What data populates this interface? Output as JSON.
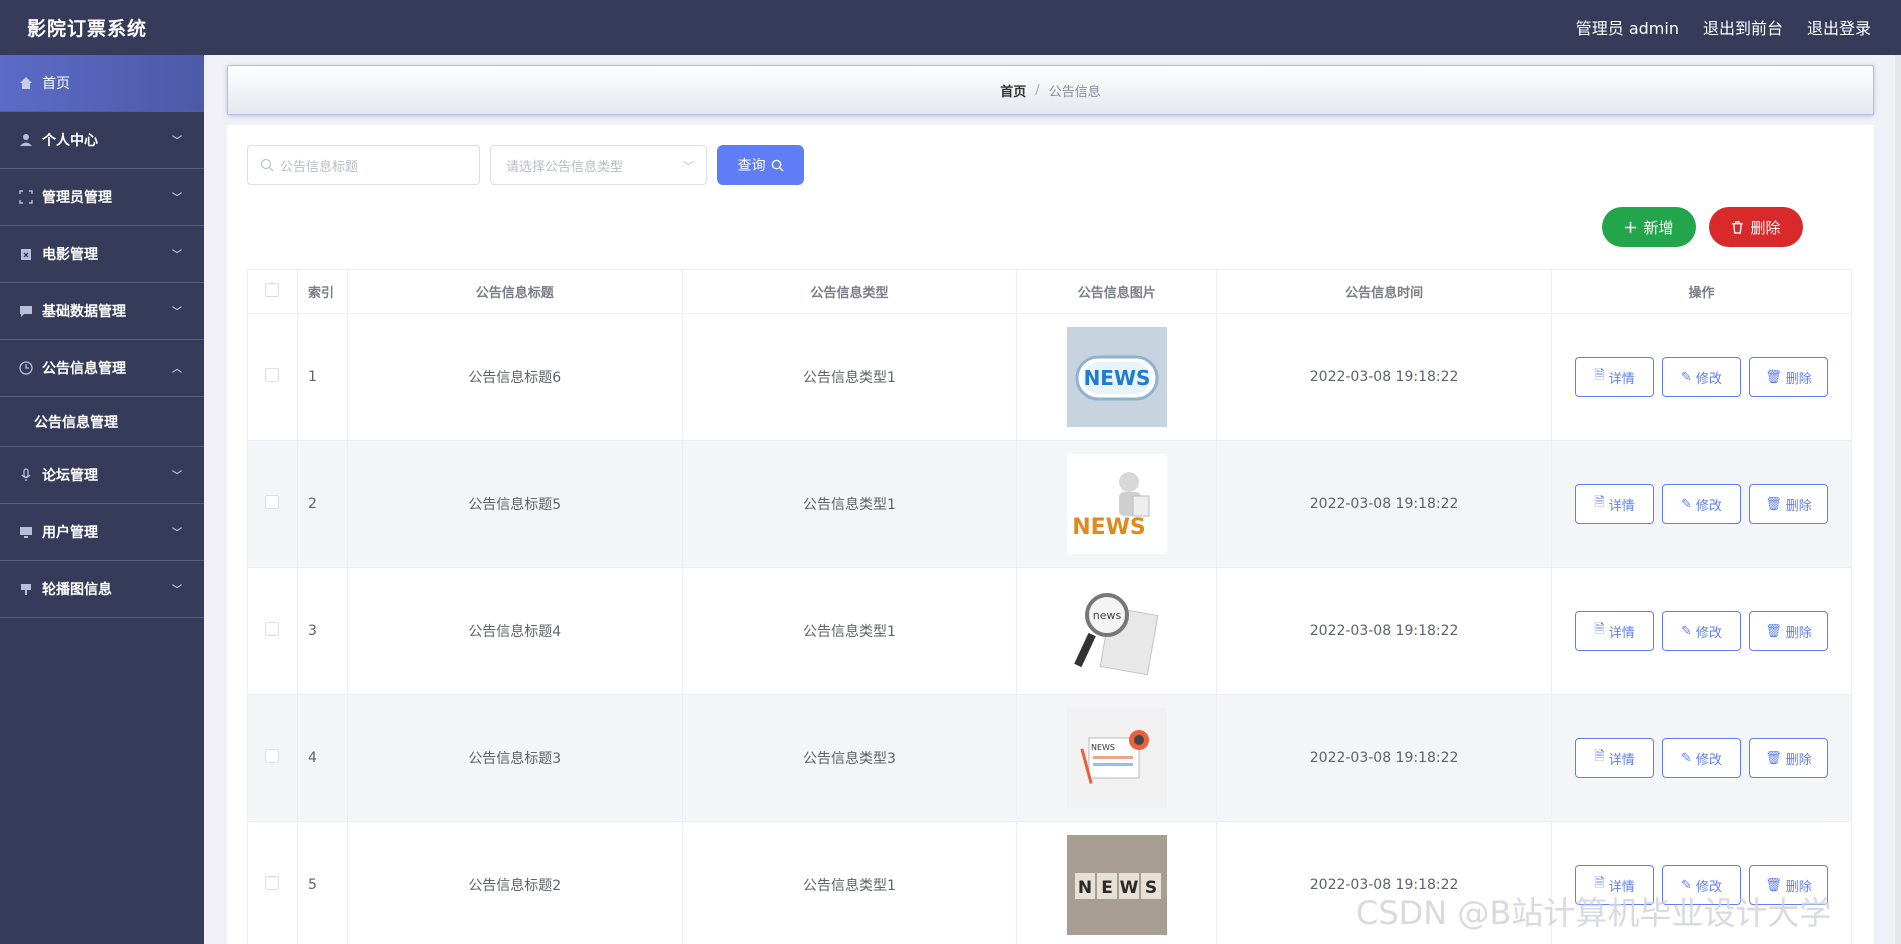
{
  "app": {
    "title": "影院订票系统",
    "user_label": "管理员 admin",
    "back_to_front": "退出到前台",
    "logout": "退出登录"
  },
  "sidebar": {
    "items": [
      {
        "label": "首页",
        "icon": "home-icon"
      },
      {
        "label": "个人中心",
        "icon": "user-icon"
      },
      {
        "label": "管理员管理",
        "icon": "frame-icon"
      },
      {
        "label": "电影管理",
        "icon": "clipboard-icon"
      },
      {
        "label": "基础数据管理",
        "icon": "chat-icon"
      },
      {
        "label": "公告信息管理",
        "icon": "clock-icon"
      },
      {
        "label": "论坛管理",
        "icon": "mic-icon"
      },
      {
        "label": "用户管理",
        "icon": "monitor-icon"
      },
      {
        "label": "轮播图信息",
        "icon": "sign-icon"
      }
    ],
    "sub_item": "公告信息管理"
  },
  "breadcrumb": {
    "home": "首页",
    "separator": "/",
    "current": "公告信息"
  },
  "search": {
    "title_placeholder": "公告信息标题",
    "type_placeholder": "请选择公告信息类型",
    "query_label": "查询"
  },
  "actions": {
    "add_label": "新增",
    "delete_label": "删除"
  },
  "table": {
    "headers": {
      "index": "索引",
      "title": "公告信息标题",
      "type": "公告信息类型",
      "image": "公告信息图片",
      "time": "公告信息时间",
      "ops": "操作"
    },
    "op_labels": {
      "detail": "详情",
      "edit": "修改",
      "delete": "删除"
    },
    "rows": [
      {
        "index": "1",
        "title": "公告信息标题6",
        "type": "公告信息类型1",
        "image": "news-badge",
        "time": "2022-03-08 19:18:22"
      },
      {
        "index": "2",
        "title": "公告信息标题5",
        "type": "公告信息类型1",
        "image": "news-figure",
        "time": "2022-03-08 19:18:22"
      },
      {
        "index": "3",
        "title": "公告信息标题4",
        "type": "公告信息类型1",
        "image": "news-magnifier",
        "time": "2022-03-08 19:18:22"
      },
      {
        "index": "4",
        "title": "公告信息标题3",
        "type": "公告信息类型3",
        "image": "news-paper",
        "time": "2022-03-08 19:18:22"
      },
      {
        "index": "5",
        "title": "公告信息标题2",
        "type": "公告信息类型1",
        "image": "news-blocks",
        "time": "2022-03-08 19:18:22"
      }
    ]
  },
  "watermark": "CSDN @B站计算机毕业设计大学",
  "colors": {
    "nav_bg": "#363b59",
    "primary": "#5f7ef6",
    "success": "#23a64b",
    "danger": "#d82a2a"
  }
}
